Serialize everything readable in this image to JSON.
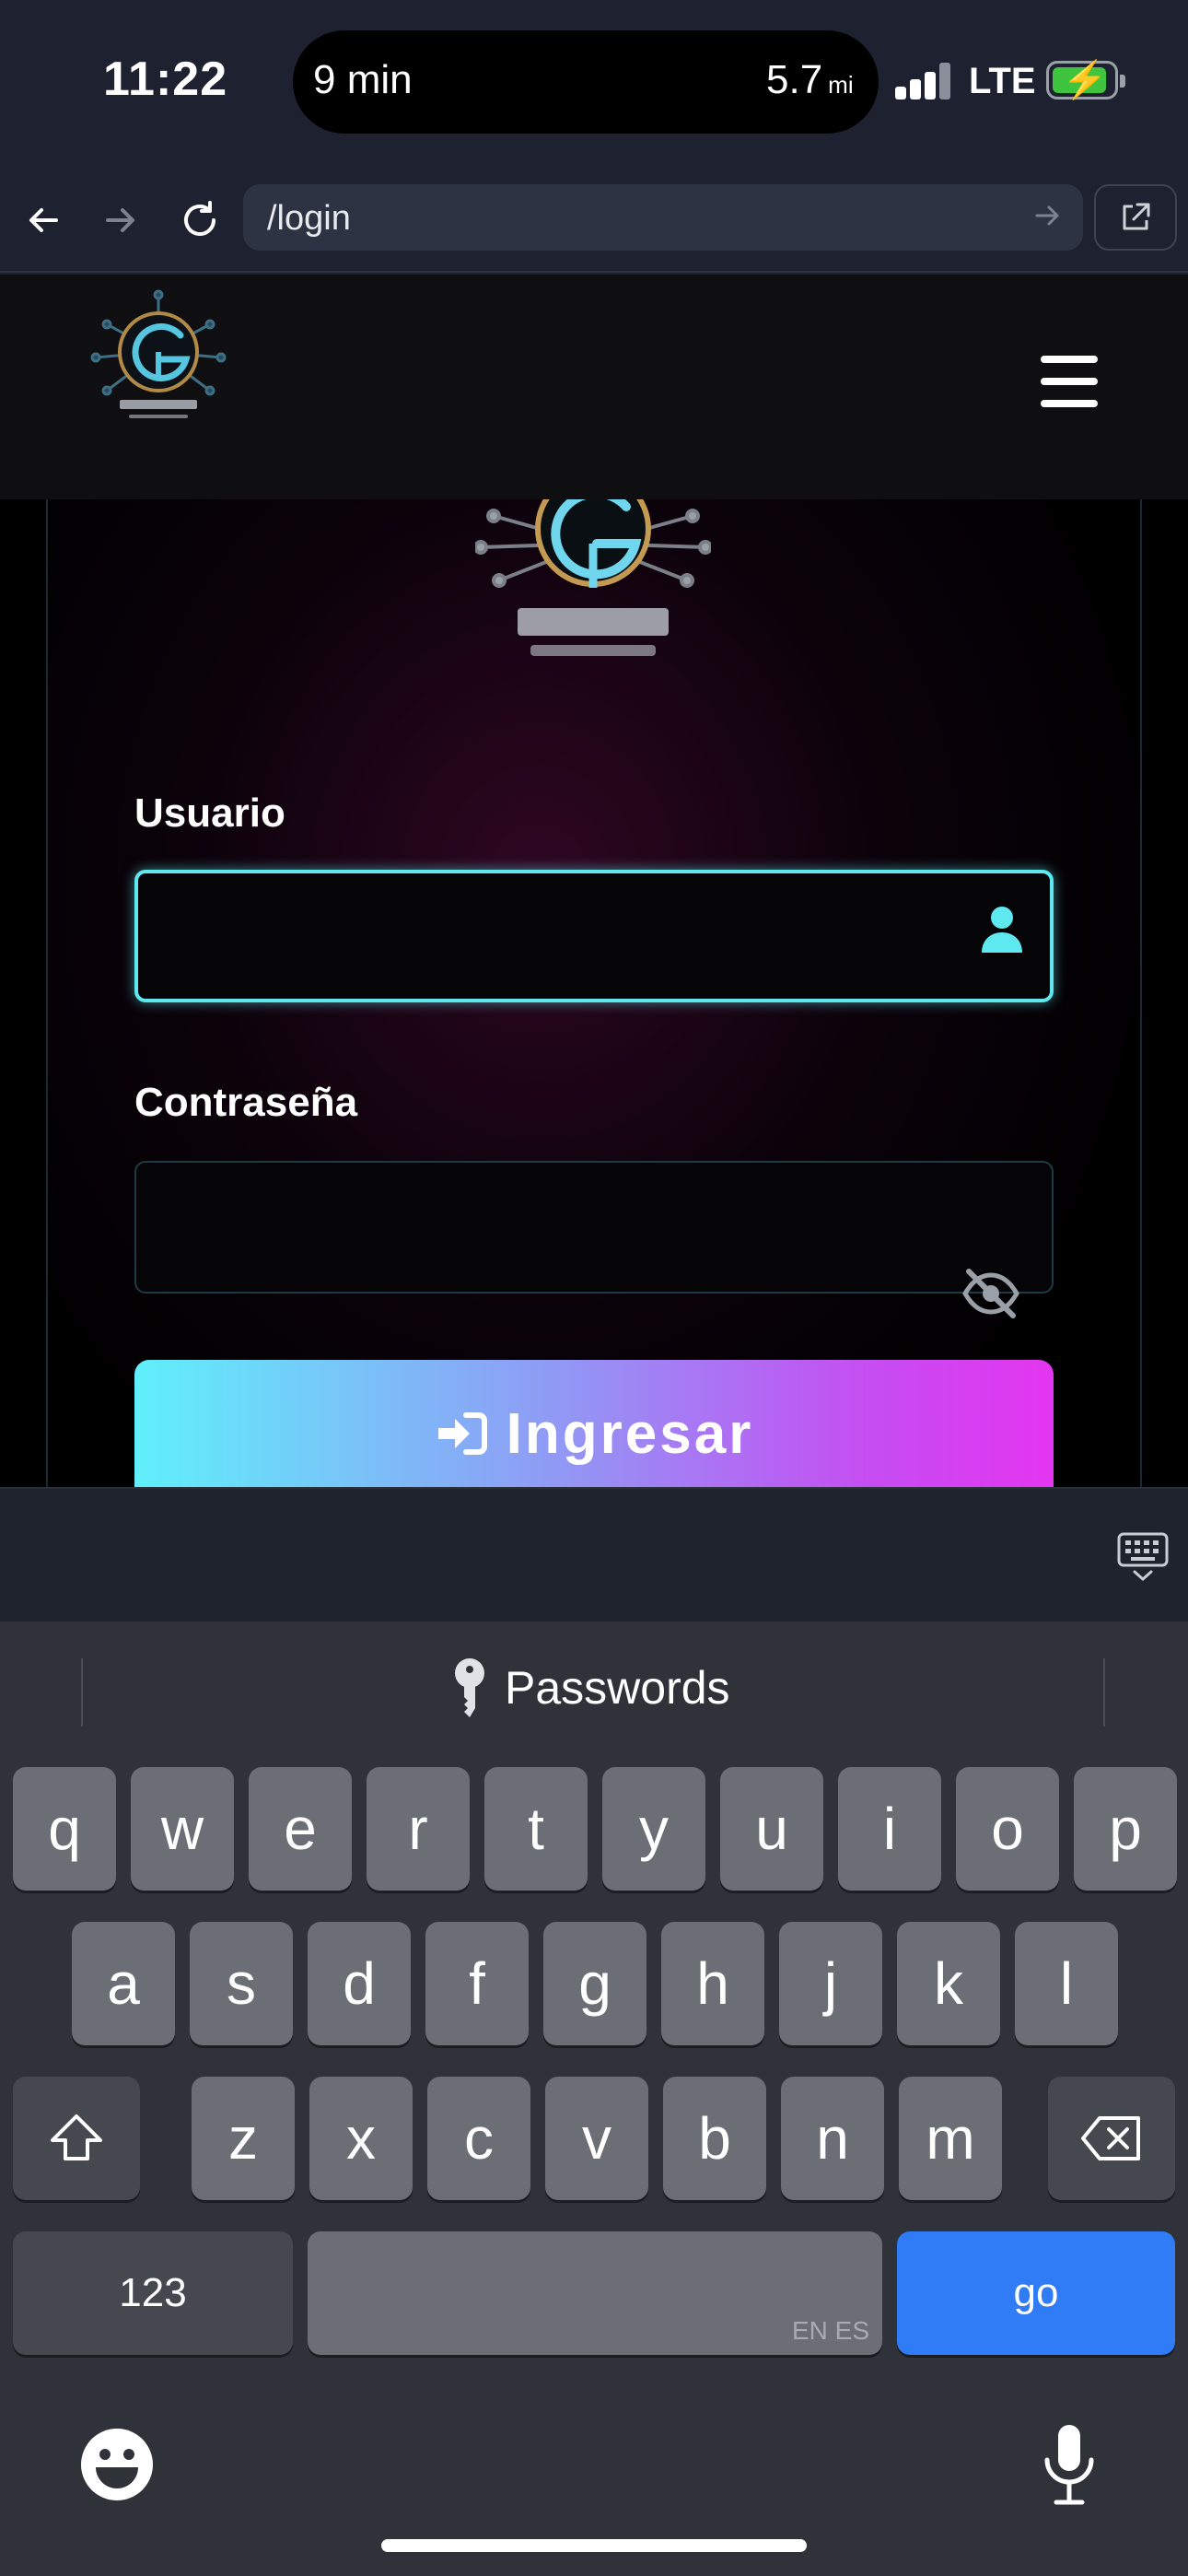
{
  "status": {
    "time": "11:22",
    "island_left": "9 min",
    "island_right_value": "5.7",
    "island_right_unit": "mi",
    "network": "LTE"
  },
  "browser": {
    "url": "/login"
  },
  "login": {
    "user_label": "Usuario",
    "user_value": "",
    "password_label": "Contraseña",
    "password_value": "",
    "submit_label": "Ingresar"
  },
  "colors": {
    "accent_cyan": "#5ee8f0",
    "accent_magenta": "#e435f0",
    "go_key": "#2f7cf6"
  },
  "keyboard": {
    "suggestion": "Passwords",
    "row1": [
      "q",
      "w",
      "e",
      "r",
      "t",
      "y",
      "u",
      "i",
      "o",
      "p"
    ],
    "row2": [
      "a",
      "s",
      "d",
      "f",
      "g",
      "h",
      "j",
      "k",
      "l"
    ],
    "row3": [
      "z",
      "x",
      "c",
      "v",
      "b",
      "n",
      "m"
    ],
    "numbers_label": "123",
    "space_sub": "EN ES",
    "go_label": "go"
  }
}
